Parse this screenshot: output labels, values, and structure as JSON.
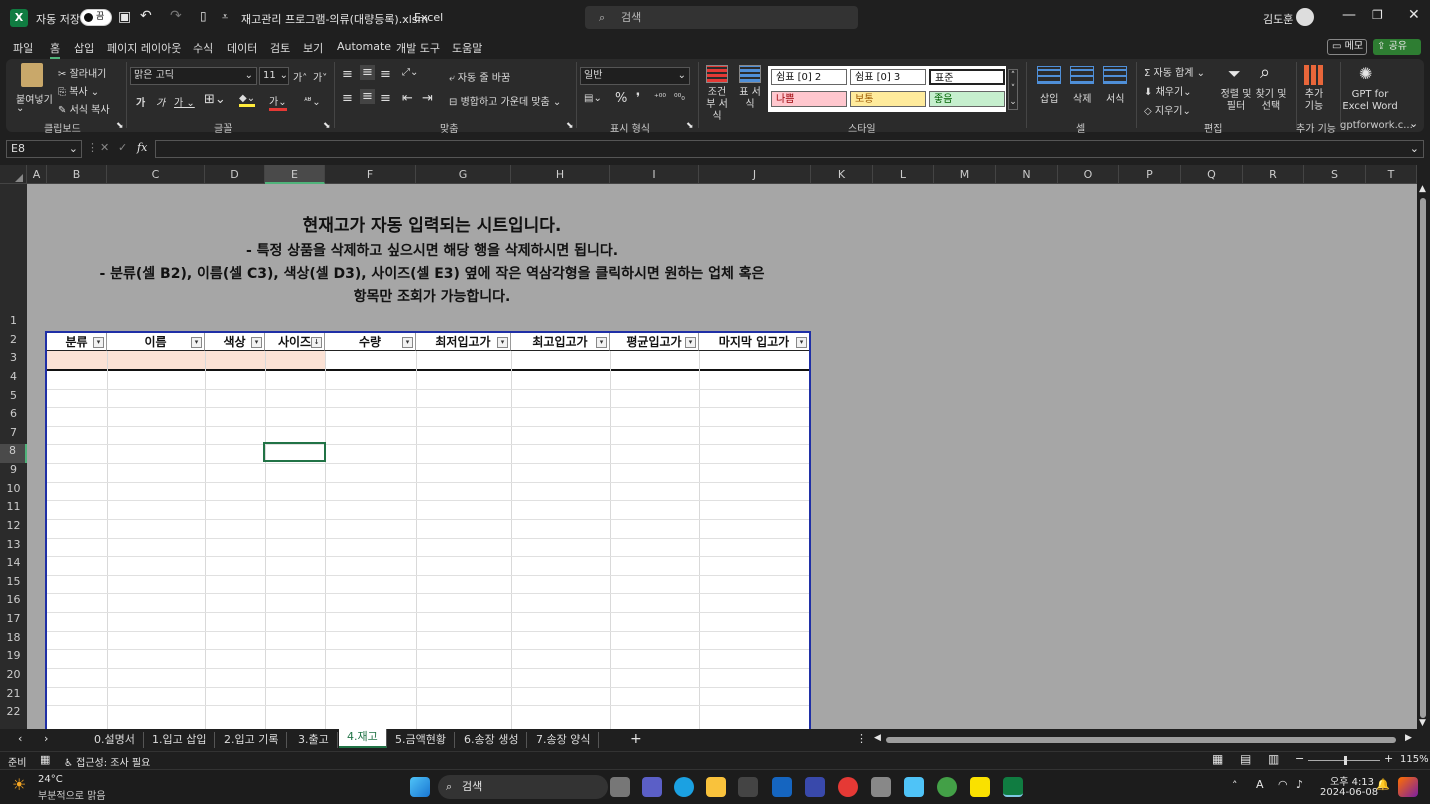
{
  "titlebar": {
    "autosave_label": "자동 저장",
    "autosave_state": "끔",
    "filename": "재고관리 프로그램-의류(대량등록).xlsm",
    "app": "Excel",
    "search_placeholder": "검색",
    "user": "김도훈"
  },
  "menu": [
    "파일",
    "홈",
    "삽입",
    "페이지 레이아웃",
    "수식",
    "데이터",
    "검토",
    "보기",
    "Automate",
    "개발 도구",
    "도움말"
  ],
  "menu_right": {
    "memo": "메모",
    "share": "공유"
  },
  "ribbon": {
    "clipboard": {
      "paste": "붙여넣기",
      "cut": "잘라내기",
      "copy": "복사",
      "format_painter": "서식 복사",
      "group": "클립보드"
    },
    "font": {
      "name": "맑은 고딕",
      "size": "11",
      "group": "글꼴"
    },
    "align": {
      "wrap": "자동 줄 바꿈",
      "merge": "병합하고 가운데 맞춤",
      "group": "맞춤"
    },
    "number": {
      "format": "일반",
      "group": "표시 형식"
    },
    "styles": {
      "conditional": "조건부 서식",
      "table": "표 서식",
      "s1": "쉼표 [0] 2",
      "s2": "쉼표 [0] 3",
      "s3": "표준",
      "s4": "나쁨",
      "s5": "보통",
      "s6": "좋음",
      "group": "스타일"
    },
    "cells": {
      "insert": "삽입",
      "delete": "삭제",
      "format": "서식",
      "group": "셀"
    },
    "editing": {
      "autosum": "자동 합계",
      "fill": "채우기",
      "clear": "지우기",
      "sort": "정렬 및 필터",
      "find": "찾기 및 선택",
      "group": "편집"
    },
    "addins": {
      "label": "추가 기능",
      "group": "추가 기능"
    },
    "gpt": {
      "label": "GPT for Excel Word",
      "group": "gptforwork.c..."
    }
  },
  "formula": {
    "cell": "E8",
    "fx": "fx"
  },
  "columns": [
    "A",
    "B",
    "C",
    "D",
    "E",
    "F",
    "G",
    "H",
    "I",
    "J",
    "K",
    "L",
    "M",
    "N",
    "O",
    "P",
    "Q",
    "R",
    "S",
    "T"
  ],
  "rows": [
    "1",
    "2",
    "3",
    "4",
    "5",
    "6",
    "7",
    "8",
    "9",
    "10",
    "11",
    "12",
    "13",
    "14",
    "15",
    "16",
    "17",
    "18",
    "19",
    "20",
    "21",
    "22"
  ],
  "notes": {
    "title": "현재고가  자동 입력되는 시트입니다.",
    "line1": "- 특정 상품을 삭제하고 싶으시면 해당 행을 삭제하시면 됩니다.",
    "line2": "- 분류(셀 B2), 이름(셀 C3), 색상(셀 D3), 사이즈(셀 E3) 옆에 작은 역삼각형을 클릭하시면 원하는 업체 혹은",
    "line3": "항목만 조회가 가능합니다."
  },
  "table": {
    "headers": [
      "분류",
      "이름",
      "색상",
      "사이즈",
      "수량",
      "최저입고가",
      "최고입고가",
      "평균입고가",
      "마지막 입고가"
    ]
  },
  "sheets": [
    "0.설명서",
    "1.입고 삽입",
    "2.입고 기록",
    "3.출고",
    "4.재고",
    "5.금액현황",
    "6.송장 생성",
    "7.송장 양식"
  ],
  "active_sheet": "4.재고",
  "status": {
    "ready": "준비",
    "accessibility": "접근성: 조사 필요",
    "zoom": "115%"
  },
  "taskbar": {
    "weather_temp": "24°C",
    "weather_desc": "부분적으로 맑음",
    "search": "검색",
    "time": "오후 4:13",
    "date": "2024-06-08"
  }
}
